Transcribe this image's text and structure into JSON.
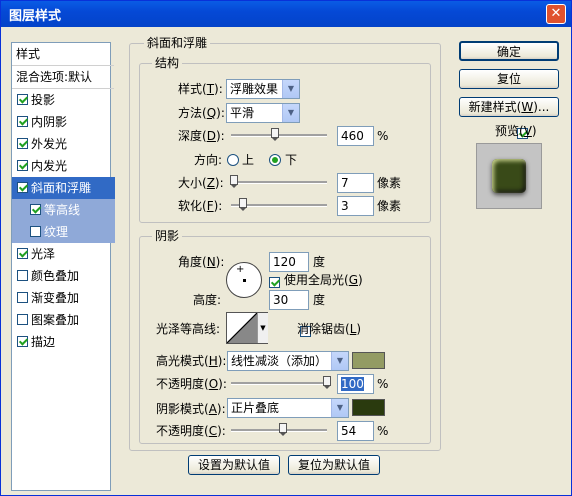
{
  "title": "图层样式",
  "colors": {
    "titlebar": "#0549d6",
    "selected": "#316ac5",
    "sub_selected": "#8fa9d8",
    "highlight_color": "#939b63",
    "shadow_color": "#2a3a0e"
  },
  "style_list": {
    "header": "样式",
    "blend": "混合选项:默认",
    "items": [
      {
        "label": "投影",
        "checked": true
      },
      {
        "label": "内阴影",
        "checked": true
      },
      {
        "label": "外发光",
        "checked": true
      },
      {
        "label": "内发光",
        "checked": true
      },
      {
        "label": "斜面和浮雕",
        "checked": true
      },
      {
        "label": "等高线",
        "checked": true
      },
      {
        "label": "纹理",
        "checked": false
      },
      {
        "label": "光泽",
        "checked": true
      },
      {
        "label": "颜色叠加",
        "checked": false
      },
      {
        "label": "渐变叠加",
        "checked": false
      },
      {
        "label": "图案叠加",
        "checked": false
      },
      {
        "label": "描边",
        "checked": true
      }
    ]
  },
  "bevel": {
    "group_title": "斜面和浮雕",
    "structure": {
      "title": "结构",
      "style_label": "样式(",
      "style_key": "T",
      "style_value": "浮雕效果",
      "technique_label": "方法(",
      "technique_key": "Q",
      "technique_value": "平滑",
      "depth_label": "深度(",
      "depth_key": "D",
      "depth_value": "460",
      "depth_unit": "%",
      "depth_level": 0.46,
      "direction_label": "方向:",
      "direction_up": "上",
      "direction_down": "下",
      "direction_selected": "down",
      "size_label": "大小(",
      "size_key": "Z",
      "size_value": "7",
      "size_unit": "像素",
      "size_level": 0.03,
      "soften_label": "软化(",
      "soften_key": "F",
      "soften_value": "3",
      "soften_unit": "像素",
      "soften_level": 0.12
    },
    "shading": {
      "title": "阴影",
      "angle_label": "角度(",
      "angle_key": "N",
      "angle_value": "120",
      "angle_unit": "度",
      "global_light_label": "使用全局光(",
      "global_light_key": "G",
      "global_light_checked": true,
      "altitude_label": "高度:",
      "altitude_value": "30",
      "altitude_unit": "度",
      "gloss_label": "光泽等高线:",
      "antialias_label": "消除锯齿(",
      "antialias_key": "L",
      "antialias_checked": false,
      "highlight_mode_label": "高光模式(",
      "highlight_mode_key": "H",
      "highlight_mode_value": "线性减淡（添加）",
      "highlight_opacity_label": "不透明度(",
      "highlight_opacity_key": "O",
      "highlight_opacity_value": "100",
      "highlight_opacity_unit": "%",
      "highlight_opacity_level": 1.0,
      "shadow_mode_label": "阴影模式(",
      "shadow_mode_key": "A",
      "shadow_mode_value": "正片叠底",
      "shadow_opacity_label": "不透明度(",
      "shadow_opacity_key": "C",
      "shadow_opacity_value": "54",
      "shadow_opacity_unit": "%",
      "shadow_opacity_level": 0.54
    },
    "close_paren": "):"
  },
  "buttons": {
    "ok": "确定",
    "reset": "复位",
    "new_style": "新建样式(",
    "new_style_key": "W",
    "new_style_suffix": ")...",
    "preview_label": "预览(",
    "preview_key": "V",
    "preview_suffix": ")",
    "preview_checked": true,
    "set_default": "设置为默认值",
    "reset_default": "复位为默认值"
  }
}
